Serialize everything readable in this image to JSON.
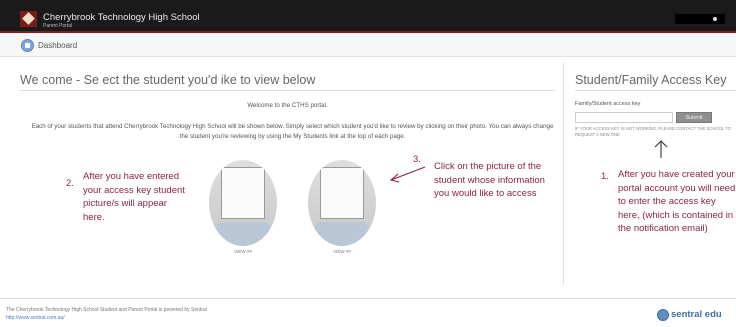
{
  "header": {
    "school_name": "Cherrybrook Technology High School",
    "portal_subtitle": "Parent Portal",
    "logo_icon": "school-crest-icon"
  },
  "breadcrumb": {
    "icon": "home-icon",
    "label": "Dashboard"
  },
  "main": {
    "title": "We come - Se ect the student you'd ike to view below",
    "welcome": "Welcome to the CTHS portal.",
    "intro": "Each of your students that attend Cherrybrook Technology High School will be shown below. Simply select which student you'd like to review by clicking on their photo. You can always change the student you're reviewing by using the My Students link at the top of each page.",
    "students": [
      {
        "caption": "VIEW ##"
      },
      {
        "caption": "VIEW ##"
      }
    ]
  },
  "annotations": {
    "left_number": "2.",
    "left_text": "After you have entered your access key student picture/s will appear here.",
    "middle_number": "3.",
    "middle_text": "Click on the picture of the student whose information you would like to access",
    "right_number": "1.",
    "right_text": "After you have created your portal account you will need to enter the access key here, (which is contained in the notification email)",
    "color": "#8b2346"
  },
  "sidebar": {
    "title": "Student/Family Access Key",
    "key_label": "Family/Student access key",
    "key_input_value": "",
    "submit_label": "Submit",
    "help_text": "IF YOUR ACCESS KEY IS NOT WORKING, PLEASE CONTACT THE SCHOOL TO REQUEST A NEW ONE"
  },
  "footer": {
    "text": "The Cherrybrook Technology High School Student and Parent Portal is powered by Sentral",
    "link": "http://www.sentral.com.au/",
    "brand": "sentral edu",
    "brand_icon": "sentral-globe-icon"
  }
}
